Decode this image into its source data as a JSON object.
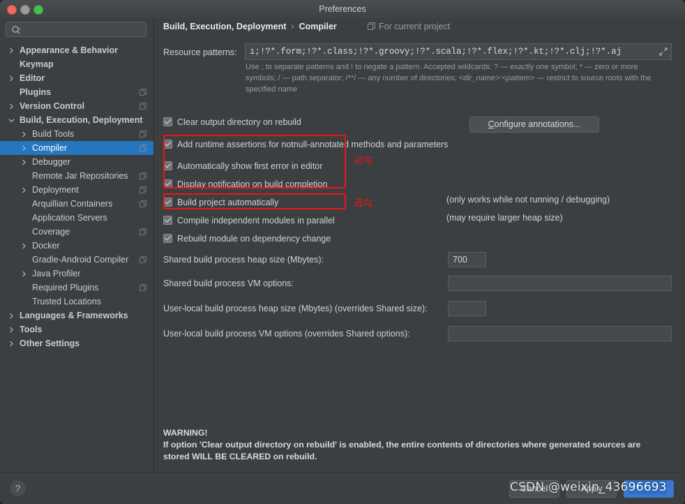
{
  "window": {
    "title": "Preferences",
    "traffic_lights": [
      "close-button",
      "minimize-button",
      "maximize-button"
    ]
  },
  "sidebar": {
    "search": {
      "value": "",
      "placeholder": "",
      "icon": "search-icon"
    },
    "items": [
      {
        "label": "Appearance & Behavior",
        "level": 0,
        "arrow": "right",
        "bold": true,
        "copy": false,
        "selected": false
      },
      {
        "label": "Keymap",
        "level": 0,
        "arrow": "none",
        "bold": true,
        "copy": false,
        "selected": false
      },
      {
        "label": "Editor",
        "level": 0,
        "arrow": "right",
        "bold": true,
        "copy": false,
        "selected": false
      },
      {
        "label": "Plugins",
        "level": 0,
        "arrow": "none",
        "bold": true,
        "copy": true,
        "selected": false
      },
      {
        "label": "Version Control",
        "level": 0,
        "arrow": "right",
        "bold": true,
        "copy": true,
        "selected": false
      },
      {
        "label": "Build, Execution, Deployment",
        "level": 0,
        "arrow": "down",
        "bold": true,
        "copy": false,
        "selected": false
      },
      {
        "label": "Build Tools",
        "level": 1,
        "arrow": "right",
        "bold": false,
        "copy": true,
        "selected": false
      },
      {
        "label": "Compiler",
        "level": 1,
        "arrow": "right",
        "bold": false,
        "copy": true,
        "selected": true
      },
      {
        "label": "Debugger",
        "level": 1,
        "arrow": "right",
        "bold": false,
        "copy": false,
        "selected": false
      },
      {
        "label": "Remote Jar Repositories",
        "level": 1,
        "arrow": "none",
        "bold": false,
        "copy": true,
        "selected": false
      },
      {
        "label": "Deployment",
        "level": 1,
        "arrow": "right",
        "bold": false,
        "copy": true,
        "selected": false
      },
      {
        "label": "Arquillian Containers",
        "level": 1,
        "arrow": "none",
        "bold": false,
        "copy": true,
        "selected": false
      },
      {
        "label": "Application Servers",
        "level": 1,
        "arrow": "none",
        "bold": false,
        "copy": false,
        "selected": false
      },
      {
        "label": "Coverage",
        "level": 1,
        "arrow": "none",
        "bold": false,
        "copy": true,
        "selected": false
      },
      {
        "label": "Docker",
        "level": 1,
        "arrow": "right",
        "bold": false,
        "copy": false,
        "selected": false
      },
      {
        "label": "Gradle-Android Compiler",
        "level": 1,
        "arrow": "none",
        "bold": false,
        "copy": true,
        "selected": false
      },
      {
        "label": "Java Profiler",
        "level": 1,
        "arrow": "right",
        "bold": false,
        "copy": false,
        "selected": false
      },
      {
        "label": "Required Plugins",
        "level": 1,
        "arrow": "none",
        "bold": false,
        "copy": true,
        "selected": false
      },
      {
        "label": "Trusted Locations",
        "level": 1,
        "arrow": "none",
        "bold": false,
        "copy": false,
        "selected": false
      },
      {
        "label": "Languages & Frameworks",
        "level": 0,
        "arrow": "right",
        "bold": true,
        "copy": false,
        "selected": false
      },
      {
        "label": "Tools",
        "level": 0,
        "arrow": "right",
        "bold": true,
        "copy": false,
        "selected": false
      },
      {
        "label": "Other Settings",
        "level": 0,
        "arrow": "right",
        "bold": true,
        "copy": false,
        "selected": false
      }
    ]
  },
  "main": {
    "breadcrumb": {
      "parent": "Build, Execution, Deployment",
      "separator": "›",
      "current": "Compiler"
    },
    "scope_badge": "For current project",
    "resource_patterns": {
      "label": "Resource patterns:",
      "value": "ı;!?*.form;!?*.class;!?*.groovy;!?*.scala;!?*.flex;!?*.kt;!?*.clj;!?*.aj",
      "expand_icon": "expand-icon"
    },
    "resource_hint_line1": "Use ; to separate patterns and ! to negate a pattern. Accepted wildcards: ? — exactly one symbol; * — zero or more",
    "resource_hint_line2_a": "symbols; / — path separator; /**/ — any number of directories; ",
    "resource_hint_line2_b": "<dir_name>:<pattern>",
    "resource_hint_line2_c": " — restrict to source roots with the",
    "resource_hint_line3": "specified name",
    "checkboxes": [
      {
        "label": "Clear output directory on rebuild",
        "checked": true,
        "mnemonic": "l"
      },
      {
        "label": "Add runtime assertions for notnull-annotated methods and parameters",
        "checked": true,
        "mnemonic": "a"
      },
      {
        "label": "Automatically show first error in editor",
        "checked": true,
        "mnemonic": "e"
      },
      {
        "label": "Display notification on build completion",
        "checked": true,
        "mnemonic": ""
      },
      {
        "label": "Build project automatically",
        "checked": true,
        "mnemonic": ""
      },
      {
        "label": "Compile independent modules in parallel",
        "checked": true,
        "mnemonic": ""
      },
      {
        "label": "Rebuild module on dependency change",
        "checked": true,
        "mnemonic": ""
      }
    ],
    "configure_annotations_button": "Configure annotations...",
    "note_build_auto": "(only works while not running / debugging)",
    "note_parallel": "(may require larger heap size)",
    "fields": [
      {
        "label": "Shared build process heap size (Mbytes):",
        "value": "700",
        "wide": false
      },
      {
        "label": "Shared build process VM options:",
        "value": "",
        "wide": true
      },
      {
        "label": "User-local build process heap size (Mbytes) (overrides Shared size):",
        "value": "",
        "wide": false
      },
      {
        "label": "User-local build process VM options (overrides Shared options):",
        "value": "",
        "wide": true
      }
    ],
    "warning_title": "WARNING!",
    "warning_line1": "If option 'Clear output directory on rebuild' is enabled, the entire contents of directories where generated sources are",
    "warning_line2": "stored WILL BE CLEARED on rebuild."
  },
  "annotations": {
    "color": "#f01414",
    "must_check": "必勾",
    "optional_check": "选勾"
  },
  "footer": {
    "help": "?",
    "cancel": "Cancel",
    "apply": "Apply",
    "ok": "OK"
  },
  "watermark": {
    "prefix": "CSDN @weixin_436",
    "highlight": "96693"
  }
}
